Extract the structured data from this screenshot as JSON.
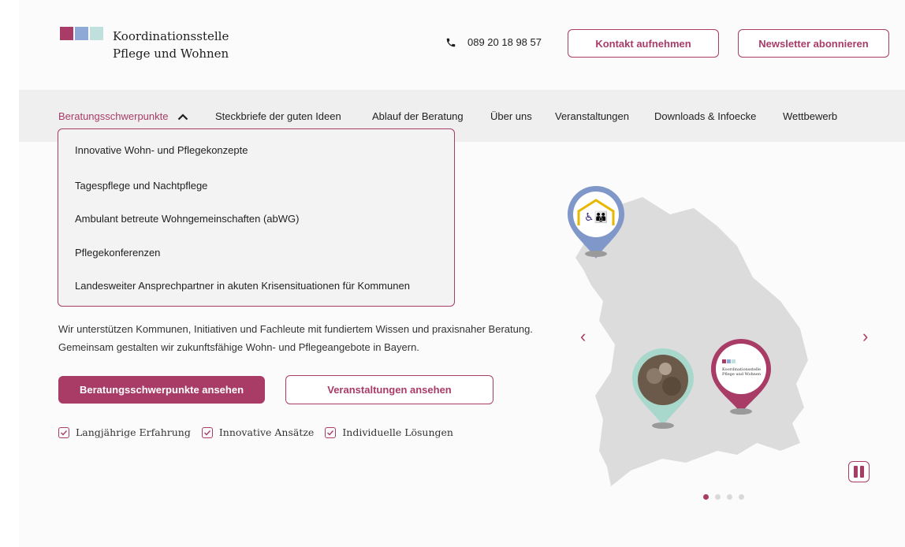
{
  "brand": {
    "name_line1": "Koordinationsstelle",
    "name_line2": "Pflege und Wohnen",
    "colors": [
      "#a83c67",
      "#8fa9d6",
      "#bfe0dc"
    ]
  },
  "header": {
    "phone_icon": "phone-icon",
    "phone": "089 20 18 98 57",
    "contact_label": "Kontakt aufnehmen",
    "newsletter_label": "Newsletter abonnieren"
  },
  "nav": {
    "items": [
      {
        "label": "Beratungsschwerpunkte"
      },
      {
        "label": "Steckbriefe der guten Ideen"
      },
      {
        "label": "Ablauf der Beratung"
      },
      {
        "label": "Über uns"
      },
      {
        "label": "Veranstaltungen"
      },
      {
        "label": "Downloads & Infoecke"
      },
      {
        "label": "Wettbewerb"
      }
    ]
  },
  "dropdown": {
    "items": [
      {
        "label": "Innovative Wohn- und Pflegekonzepte"
      },
      {
        "label": "Tagespflege und Nachtpflege"
      },
      {
        "label": "Ambulant betreute Wohngemeinschaften (abWG)"
      },
      {
        "label": "Pflegekonferenzen"
      },
      {
        "label": "Landesweiter Ansprechpartner in akuten Krisensituationen für Kommunen"
      }
    ]
  },
  "hero": {
    "intro": "Wir unterstützen Kommunen, Initiativen und Fachleute mit fundiertem Wissen und praxisnaher Beratung. Gemeinsam gestalten wir zukunftsfähige Wohn- und Pflegeangebote in Bayern.",
    "primary_button": "Beratungsschwerpunkte ansehen",
    "secondary_button": "Veranstaltungen ansehen",
    "features": [
      {
        "label": "Langjährige Erfahrung"
      },
      {
        "label": "Innovative Ansätze"
      },
      {
        "label": "Individuelle Lösungen"
      }
    ]
  },
  "map_pin_logo": {
    "line1": "Koordinationsstelle",
    "line2": "Pflege und Wohnen"
  },
  "carousel": {
    "prev": "‹",
    "next": "›",
    "slides": 4,
    "active_slide": 1
  },
  "theme": {
    "accent": "#a83c67",
    "map_fill": "#dcdcdc"
  }
}
